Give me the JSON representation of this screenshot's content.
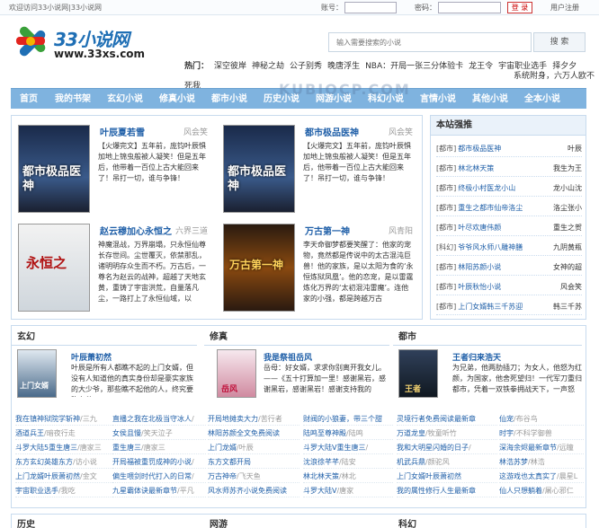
{
  "topbar": {
    "welcome": "欢迎访问33小说网|33小说网",
    "account_label": "账号：",
    "password_label": "密码：",
    "login_button": "登 录",
    "register": "用户注册"
  },
  "logo": {
    "name": "33小说网",
    "url": "www.33xs.com"
  },
  "search": {
    "placeholder": "输入需要搜索的小说",
    "button": "搜 索"
  },
  "hot": {
    "label": "热门：",
    "items": [
      "深空彼岸",
      "神秘之劫",
      "公子别秀",
      "晚唐浮生",
      "NBA：开局一张三分体验卡",
      "龙王令",
      "宇宙职业选手",
      "择夕夕",
      "系统附身，六万人欧不死我"
    ]
  },
  "nav": [
    "首页",
    "我的书架",
    "玄幻小说",
    "修真小说",
    "都市小说",
    "历史小说",
    "网游小说",
    "科幻小说",
    "言情小说",
    "其他小说",
    "全本小说"
  ],
  "watermark": "KUBIOCP.COM",
  "featured": [
    {
      "title": "叶辰夏若雪",
      "author": "风会笑",
      "desc": "【火爆完文】五年前，庞钧叶辰惧加地上锦虫般被人凝笑！但是五年后，他带着一百位上古大能回来了！吊打一切，谁与争锋！",
      "cover_text": "都市极品医神"
    },
    {
      "title": "都市极品医神",
      "author": "风会笑",
      "desc": "【火爆完文】五年前，庞钧叶辰惧加地上锦虫般被人凝笑！但是五年后，他带着一百位上古大能回来了！吊打一切，谁与争锋！",
      "cover_text": "都市极品医神"
    },
    {
      "title": "赵云穆加心永恒之",
      "author": "六界三道",
      "desc": "神魔混战，万界崩塌，只永恒仙尊长存世间。尘世覆灭，依禁那乱，诸明明存众生而不朽。万古后，一尊名为赵云的战神，超越了天地玄黄，重铸了宇宙洪荒，自量落凡尘，一路打上了永恒仙域，以",
      "cover_text": "永恒之"
    },
    {
      "title": "万古第一神",
      "author": "风青阳",
      "desc": "李天命御梦都要笑醒了：他家的宠物，竟然都是传说中的太古混沌巨兽！他的家族，是以太阳为食的‘永恒炼狱凤凰’。他的恋宠，是以雷霆炼化万界的‘太初混沌雷魔’。连他家的小强，都是跨越万古",
      "cover_text": "万古第一神"
    }
  ],
  "rank": {
    "title": "本站强推",
    "rows": [
      {
        "cat": "[都市]",
        "book": "都市极品医神",
        "author": "叶辰"
      },
      {
        "cat": "[都市]",
        "book": "林北林天策",
        "author": "我生为王"
      },
      {
        "cat": "[都市]",
        "book": "终极小村医龙小山",
        "author": "龙小山沈"
      },
      {
        "cat": "[都市]",
        "book": "重生之都市仙帝洛尘",
        "author": "洛尘张小"
      },
      {
        "cat": "[都市]",
        "book": "叶尽欢唐伟颜",
        "author": "重生之贺"
      },
      {
        "cat": "[科幻]",
        "book": "爷爷风水师八雕神膳",
        "author": "九阴黄瓶"
      },
      {
        "cat": "[都市]",
        "book": "林阳苏颜小说",
        "author": "女神的超"
      },
      {
        "cat": "[都市]",
        "book": "叶辰秋怡小说",
        "author": "风会笑"
      },
      {
        "cat": "[都市]",
        "book": "上门女婿韩三千苏迎",
        "author": "韩三千苏"
      }
    ]
  },
  "columns": [
    {
      "title": "玄幻",
      "feat_title": "叶辰萧初然",
      "feat_author": "",
      "feat_desc": "叶辰是所有人都瞧不起的上门女婿，但没有人知道他的真实身份却是豪实家族的大少爷，那些瞧不起他的人，终究要跪在他",
      "cover_text": "上门女婿",
      "links": [
        {
          "t": "我在镇神狱院学斩神",
          "a": "/三九"
        },
        {
          "t": "酒道兵王",
          "a": "/暗夜行走"
        },
        {
          "t": "斗罗大陆5重生唐三",
          "a": "/唐家三"
        },
        {
          "t": "东方玄幻英雄东方",
          "a": "/访小说"
        },
        {
          "t": "上门龙婿叶辰萧初然",
          "a": "/金文"
        },
        {
          "t": "宇宙职业选手",
          "a": "/我吃"
        }
      ],
      "links2": [
        {
          "t": "直播之我在北极当守冰人",
          "a": "/"
        },
        {
          "t": "女侯且慢",
          "a": "/笑天泣子"
        },
        {
          "t": "重生唐三",
          "a": "/唐家三"
        },
        {
          "t": "开局福被重罚成神的小说",
          "a": "/"
        },
        {
          "t": "偏生喂剑时代打入的日常",
          "a": "/"
        },
        {
          "t": "九星霸体诀最新章节",
          "a": "/平凡"
        }
      ]
    },
    {
      "title": "修真",
      "feat_title": "我是祭祖岳风",
      "feat_author": "",
      "feat_desc": "岳母：好女婿，求求你别离开我女儿。——《五十打算加一里！感谢黑岩，感谢黑岩，感谢黑岩！感谢支持我的",
      "cover_text": "岳风",
      "links": [
        {
          "t": "开局地摊卖大力",
          "a": "/苦行者"
        },
        {
          "t": "林阳苏颜全文免费阅读",
          "a": ""
        },
        {
          "t": "上门龙婿",
          "a": "/叶辰"
        },
        {
          "t": "东方文都开局",
          "a": ""
        },
        {
          "t": "万古神帝",
          "a": "/飞天鱼"
        },
        {
          "t": "风水师苏齐小说免费阅读",
          "a": ""
        }
      ],
      "links2": [
        {
          "t": "财阀的小狼妻，带三个甜",
          "a": ""
        },
        {
          "t": "陆鸣至尊神殿",
          "a": "/陆鸣"
        },
        {
          "t": "斗罗大陆V重生唐三",
          "a": "/"
        },
        {
          "t": "沈浪徐芊芊",
          "a": "/陆安"
        },
        {
          "t": "林北林天策",
          "a": "/林北"
        },
        {
          "t": "斗罗大陆V",
          "a": "/唐家"
        }
      ]
    },
    {
      "title": "都市",
      "feat_title": "王者归来浩天",
      "feat_author": "",
      "feat_desc": "为兄弟，他两肋插刀；为女人，他怒为红颜，为国家，他舍死望归！一代军刀重归都市，凭着一双铁拳拥战天下，一声怒",
      "cover_text": "王者",
      "links": [
        {
          "t": "灵境行者免费阅读最新章",
          "a": ""
        },
        {
          "t": "万道龙皇",
          "a": "/牧童听竹"
        },
        {
          "t": "我和大明星闪婚的日子",
          "a": "/"
        },
        {
          "t": "机武兵鼎",
          "a": "/颜驼风"
        },
        {
          "t": "上门女婿叶辰萧初然",
          "a": ""
        },
        {
          "t": "我的属性修行人生最新章",
          "a": ""
        }
      ],
      "links2": [
        {
          "t": "仙宠",
          "a": "/布谷鸟"
        },
        {
          "t": "时宇",
          "a": "/不科学御兽"
        },
        {
          "t": "深海余烬最新章节",
          "a": "/远瞳"
        },
        {
          "t": "林浩苏梦",
          "a": "/林浩"
        },
        {
          "t": "这游戏也太真实了",
          "a": "/晨星L"
        },
        {
          "t": "仙人只想躺着",
          "a": "/屠心邪仁"
        }
      ]
    }
  ],
  "bottom_columns": [
    "历史",
    "网游",
    "科幻"
  ]
}
